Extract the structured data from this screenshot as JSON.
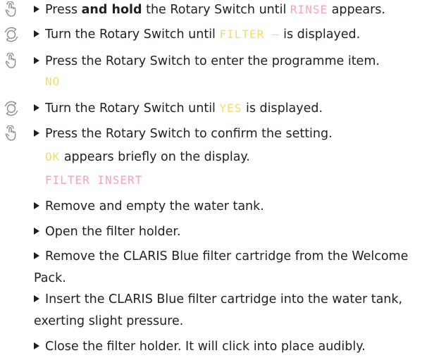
{
  "steps": [
    {
      "icon": "press-hold-icon",
      "pre": "Press ",
      "bold": "and hold",
      "mid": " the Rotary Switch until ",
      "display": "RINSE",
      "post": " appears."
    },
    {
      "icon": "rotate-icon",
      "pre": "Turn the Rotary Switch until ",
      "display": "FILTER –",
      "post": " is displayed."
    },
    {
      "icon": "press-icon",
      "text": "Press the Rotary Switch to enter the programme item.",
      "display_line": "NO"
    },
    {
      "icon": "rotate-icon",
      "pre": "Turn the Rotary Switch until ",
      "display": "YES",
      "post": " is displayed."
    },
    {
      "icon": "press-icon",
      "text": "Press the Rotary Switch to confirm the setting.",
      "display": "OK",
      "post": " appears briefly on the display.",
      "display_line": "FILTER INSERT"
    }
  ],
  "bullets": [
    "Remove and empty the water tank.",
    "Open the filter holder.",
    "Remove the CLARIS Blue filter cartridge from the Welcome Pack.",
    "Insert the CLARIS Blue filter cartridge into the water tank, exerting slight pressure.",
    "Close the filter holder. It will click into place audibly."
  ],
  "colors": {
    "text": "#231f20",
    "display_pink": "#f5a3b8",
    "display_yellow": "#f4dc6a",
    "icon_gray": "#8a8a8a"
  }
}
